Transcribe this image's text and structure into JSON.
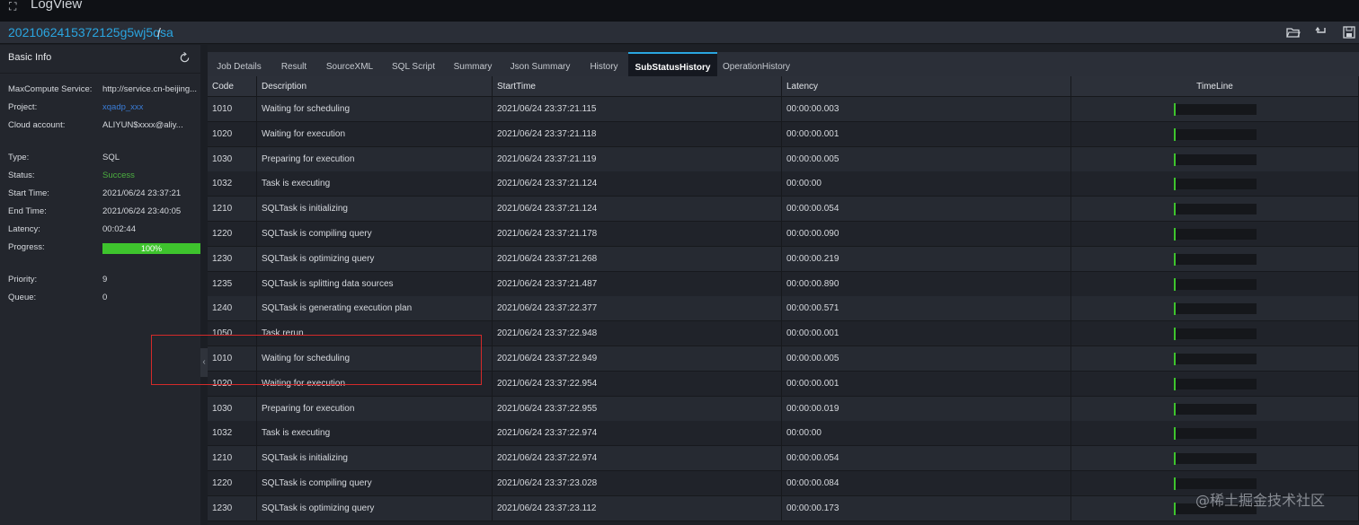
{
  "window": {
    "title": "LogView"
  },
  "path": {
    "job_id": "2021062415372125g5wj5qsa",
    "separator": "/"
  },
  "left_panel": {
    "title": "Basic Info",
    "rows": [
      {
        "label": "MaxCompute Service:",
        "value": "http://service.cn-beijing...",
        "style": "normal"
      },
      {
        "label": "Project:",
        "value": "xqadp_xxx",
        "style": "blue"
      },
      {
        "label": "Cloud account:",
        "value": "ALIYUN$xxxx@aliy...",
        "style": "normal"
      },
      {
        "label": "Type:",
        "value": "SQL",
        "style": "normal"
      },
      {
        "label": "Status:",
        "value": "Success",
        "style": "green"
      },
      {
        "label": "Start Time:",
        "value": "2021/06/24 23:37:21",
        "style": "normal"
      },
      {
        "label": "End Time:",
        "value": "2021/06/24 23:40:05",
        "style": "normal"
      },
      {
        "label": "Latency:",
        "value": "00:02:44",
        "style": "normal"
      },
      {
        "label": "Progress:",
        "value": "",
        "style": "normal"
      },
      {
        "label": "Priority:",
        "value": "9",
        "style": "normal"
      },
      {
        "label": "Queue:",
        "value": "0",
        "style": "normal"
      }
    ],
    "progress": {
      "percent": 100,
      "label": "100%"
    }
  },
  "tabs": [
    {
      "label": "Job Details",
      "active": false
    },
    {
      "label": "Result",
      "active": false
    },
    {
      "label": "SourceXML",
      "active": false
    },
    {
      "label": "SQL Script",
      "active": false
    },
    {
      "label": "Summary",
      "active": false
    },
    {
      "label": "Json Summary",
      "active": false
    },
    {
      "label": "History",
      "active": false
    },
    {
      "label": "SubStatusHistory",
      "active": true
    },
    {
      "label": "OperationHistory",
      "active": false
    }
  ],
  "table": {
    "columns": [
      "Code",
      "Description",
      "StartTime",
      "Latency",
      "TimeLine"
    ],
    "rows": [
      {
        "code": "1010",
        "description": "Waiting for scheduling",
        "start": "2021/06/24 23:37:21.115",
        "latency": "00:00:00.003"
      },
      {
        "code": "1020",
        "description": "Waiting for execution",
        "start": "2021/06/24 23:37:21.118",
        "latency": "00:00:00.001"
      },
      {
        "code": "1030",
        "description": "Preparing for execution",
        "start": "2021/06/24 23:37:21.119",
        "latency": "00:00:00.005"
      },
      {
        "code": "1032",
        "description": "Task is executing",
        "start": "2021/06/24 23:37:21.124",
        "latency": "00:00:00"
      },
      {
        "code": "1210",
        "description": "SQLTask is initializing",
        "start": "2021/06/24 23:37:21.124",
        "latency": "00:00:00.054"
      },
      {
        "code": "1220",
        "description": "SQLTask is compiling query",
        "start": "2021/06/24 23:37:21.178",
        "latency": "00:00:00.090"
      },
      {
        "code": "1230",
        "description": "SQLTask is optimizing query",
        "start": "2021/06/24 23:37:21.268",
        "latency": "00:00:00.219"
      },
      {
        "code": "1235",
        "description": "SQLTask is splitting data sources",
        "start": "2021/06/24 23:37:21.487",
        "latency": "00:00:00.890"
      },
      {
        "code": "1240",
        "description": "SQLTask is generating execution plan",
        "start": "2021/06/24 23:37:22.377",
        "latency": "00:00:00.571"
      },
      {
        "code": "1050",
        "description": "Task rerun",
        "start": "2021/06/24 23:37:22.948",
        "latency": "00:00:00.001"
      },
      {
        "code": "1010",
        "description": "Waiting for scheduling",
        "start": "2021/06/24 23:37:22.949",
        "latency": "00:00:00.005"
      },
      {
        "code": "1020",
        "description": "Waiting for execution",
        "start": "2021/06/24 23:37:22.954",
        "latency": "00:00:00.001"
      },
      {
        "code": "1030",
        "description": "Preparing for execution",
        "start": "2021/06/24 23:37:22.955",
        "latency": "00:00:00.019"
      },
      {
        "code": "1032",
        "description": "Task is executing",
        "start": "2021/06/24 23:37:22.974",
        "latency": "00:00:00"
      },
      {
        "code": "1210",
        "description": "SQLTask is initializing",
        "start": "2021/06/24 23:37:22.974",
        "latency": "00:00:00.054"
      },
      {
        "code": "1220",
        "description": "SQLTask is compiling query",
        "start": "2021/06/24 23:37:23.028",
        "latency": "00:00:00.084"
      },
      {
        "code": "1230",
        "description": "SQLTask is optimizing query",
        "start": "2021/06/24 23:37:23.112",
        "latency": "00:00:00.173"
      }
    ]
  },
  "watermark": "@稀土掘金技术社区",
  "colors": {
    "accent": "#2aa5e0",
    "success": "#3ec42d",
    "highlight": "#d42a2a"
  },
  "icons": {
    "window": "expand-icon",
    "open": "folder-open-icon",
    "undo": "undo-icon",
    "save": "save-icon",
    "refresh": "refresh-icon"
  }
}
